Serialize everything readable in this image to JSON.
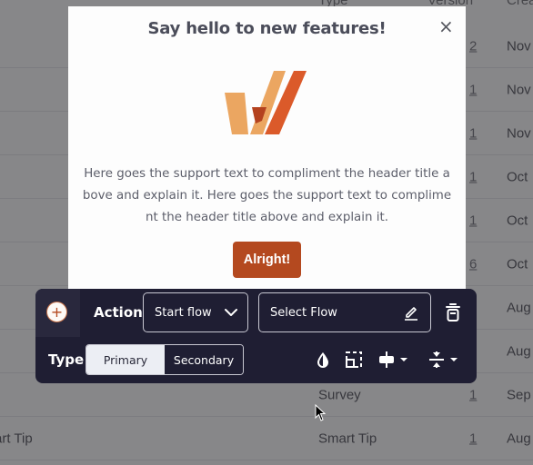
{
  "background_table": {
    "columns": [
      "Type",
      "Version",
      "Created"
    ],
    "rows": [
      {
        "name": "",
        "type": "",
        "version": "2",
        "created": "Nov"
      },
      {
        "name": "",
        "type": "",
        "version": "1",
        "created": "Nov"
      },
      {
        "name": "",
        "type": "",
        "version": "1",
        "created": "Nov"
      },
      {
        "name": "",
        "type": "",
        "version": "1",
        "created": "Oct"
      },
      {
        "name": "",
        "type": "",
        "version": "1",
        "created": "Oct"
      },
      {
        "name": "",
        "type": "",
        "version": "6",
        "created": "Oct"
      },
      {
        "name": "",
        "type": "",
        "version": "",
        "created": "Aug"
      },
      {
        "name": "",
        "type": "",
        "version": "",
        "created": "Aug"
      },
      {
        "name": "",
        "type": "Survey",
        "version": "1",
        "created": "Sep"
      },
      {
        "name": "art Tip",
        "type": "Smart Tip",
        "version": "1",
        "created": "Aug"
      }
    ]
  },
  "modal": {
    "title": "Say hello to new features!",
    "close_icon": "×",
    "logo": "whatfix-w-logo",
    "body_text": "Here goes the support text to compliment the header title above and explain it. Here goes the support text to compliment the header title above and explain it.",
    "button_label": "Alright!",
    "button_color": "#b4491f",
    "logo_colors": [
      "#eba661",
      "#b4421f",
      "#db5a2a"
    ]
  },
  "toolbar": {
    "add_icon": "+",
    "action_label": "Action",
    "action_value": "Start flow",
    "flow_placeholder": "Select Flow",
    "type_label": "Type",
    "type_options": [
      "Primary",
      "Secondary"
    ],
    "type_selected": "Primary",
    "icons": [
      "color-drop-icon",
      "resize-icon",
      "align-icon",
      "spacing-icon"
    ],
    "background_color": "#1f1e33"
  }
}
